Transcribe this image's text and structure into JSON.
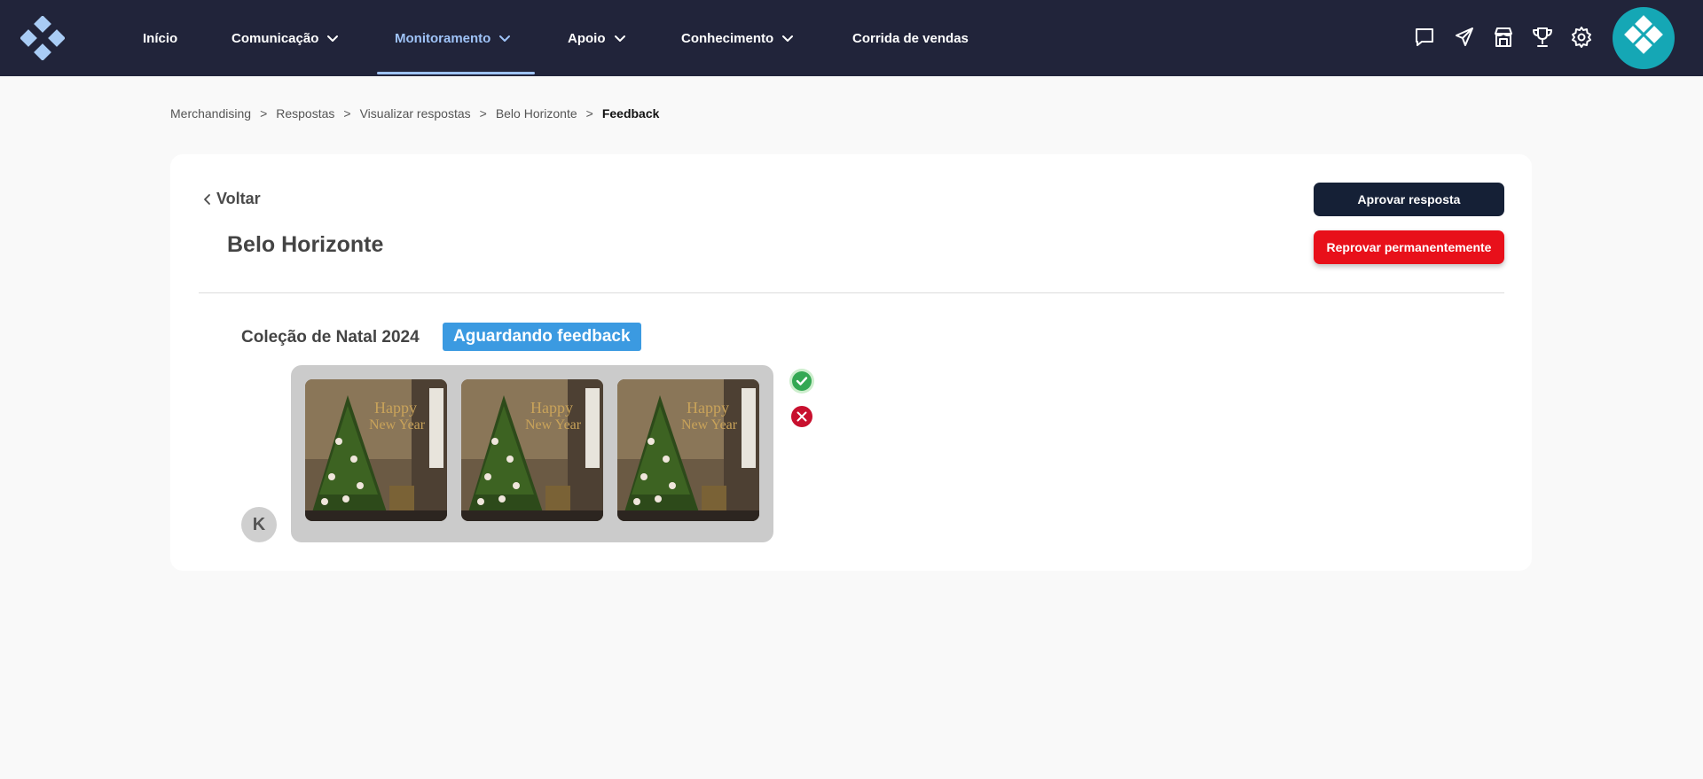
{
  "nav": {
    "items": [
      {
        "label": "Início"
      },
      {
        "label": "Comunicação"
      },
      {
        "label": "Monitoramento"
      },
      {
        "label": "Apoio"
      },
      {
        "label": "Conhecimento"
      },
      {
        "label": "Corrida de vendas"
      }
    ],
    "active": "Monitoramento",
    "icons": [
      "chat-icon",
      "send-icon",
      "store-icon",
      "trophy-icon",
      "gear-icon"
    ]
  },
  "breadcrumb": {
    "items": [
      "Merchandising",
      "Respostas",
      "Visualizar respostas",
      "Belo Horizonte"
    ],
    "current": "Feedback"
  },
  "page": {
    "back_label": "Voltar",
    "title": "Belo Horizonte",
    "approve_label": "Aprovar resposta",
    "reject_label": "Reprovar permanentemente"
  },
  "submission": {
    "collection": "Coleção de Natal 2024",
    "status": "Aguardando feedback",
    "user_initial": "K",
    "photo_count": 3
  },
  "colors": {
    "topbar": "#21243a",
    "accent": "#9fc3f7",
    "approve": "#152036",
    "reject": "#e8101a",
    "badge": "#3b9ae1"
  }
}
